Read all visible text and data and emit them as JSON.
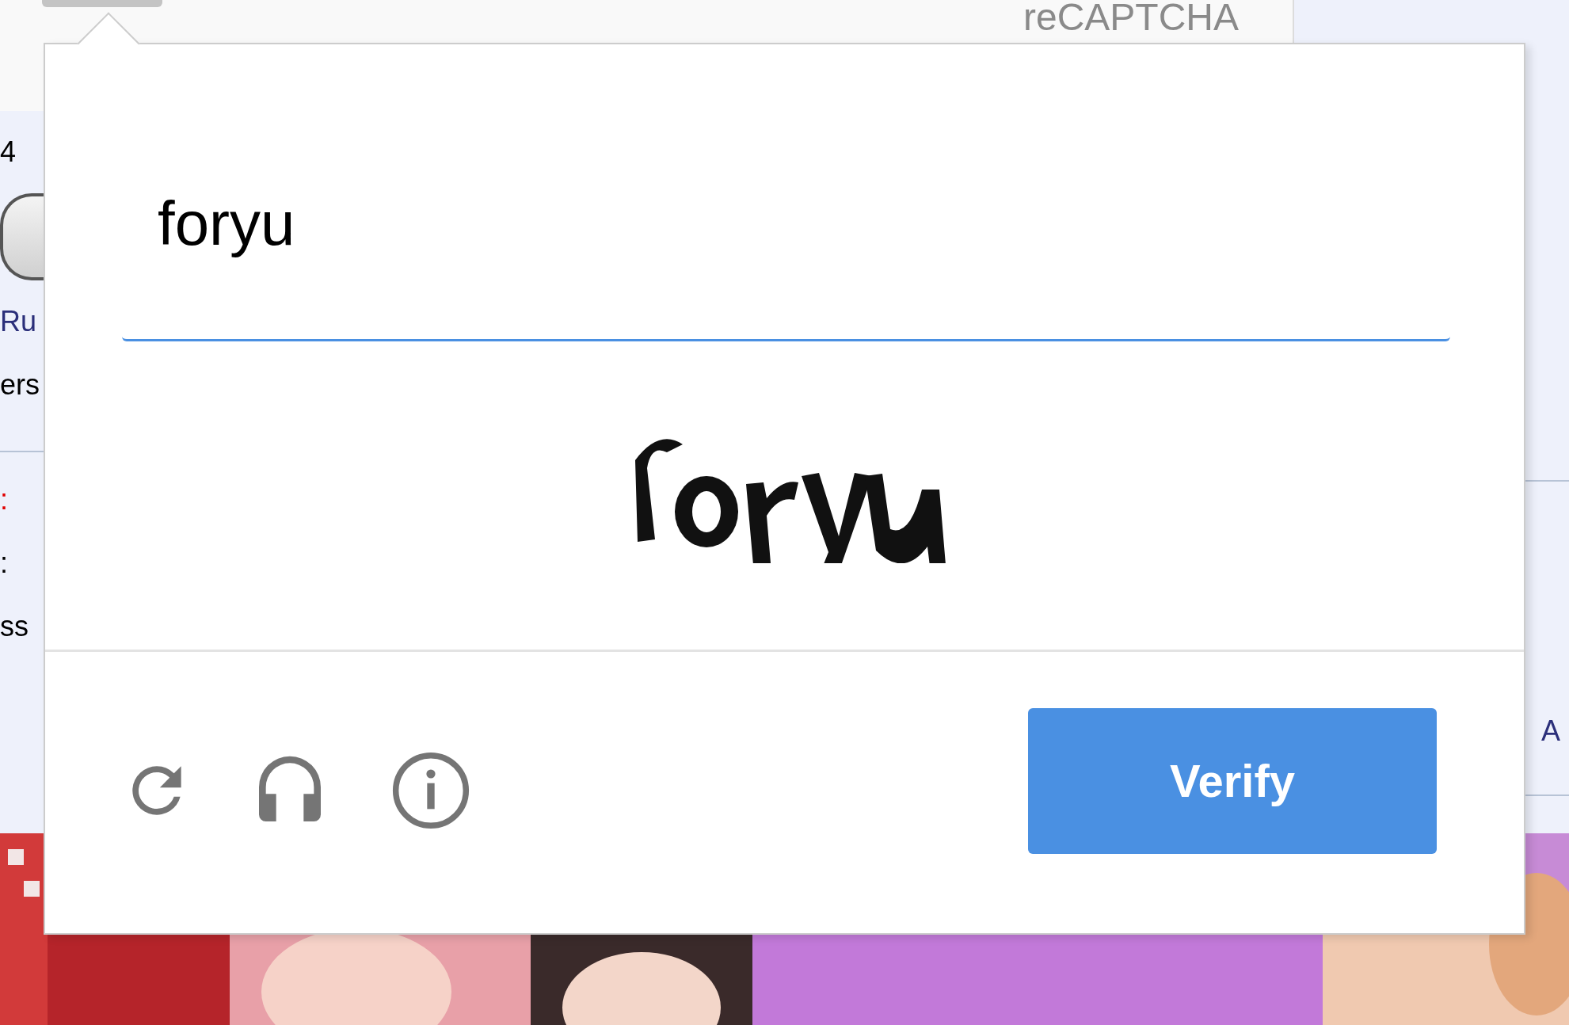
{
  "page_behind": {
    "header_label": "reCAPTCHA",
    "left_fragments": [
      {
        "text": "4",
        "kind": "plain"
      },
      {
        "kind": "button"
      },
      {
        "text": "Ru",
        "kind": "link"
      },
      {
        "text": "ers",
        "kind": "plain"
      },
      {
        "text": ":",
        "kind": "alert"
      },
      {
        "text": ":",
        "kind": "plain"
      },
      {
        "text": "ss",
        "kind": "plain"
      }
    ],
    "right_fragments": [
      {
        "text": "A",
        "kind": "link"
      }
    ]
  },
  "challenge": {
    "response": "foryu",
    "button": "Verify"
  }
}
